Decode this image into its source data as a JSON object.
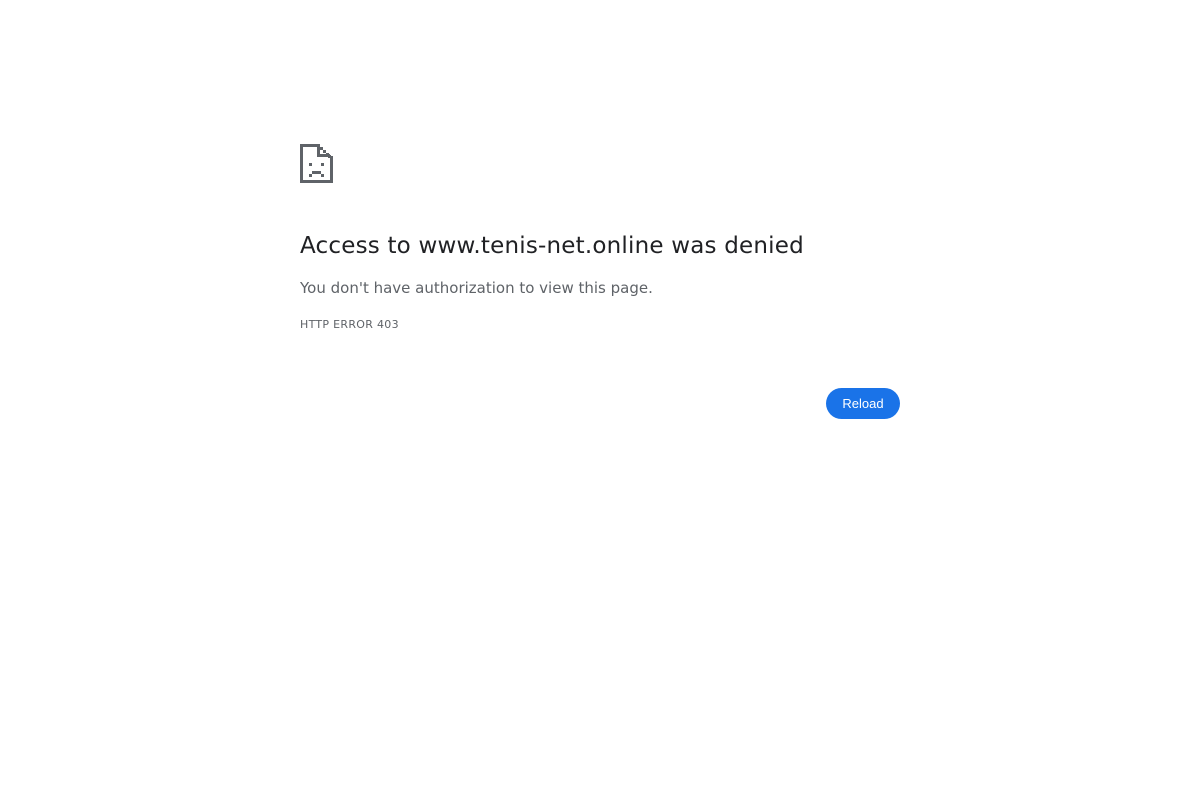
{
  "error_page": {
    "icon": "sad-document-icon",
    "heading_prefix": "Access to ",
    "host": "www.tenis-net.online",
    "heading_suffix": " was denied",
    "message": "You don't have authorization to view this page.",
    "error_code": "HTTP ERROR 403",
    "reload_label": "Reload"
  },
  "colors": {
    "heading": "#202124",
    "secondary_text": "#5f6368",
    "button_bg": "#1a73e8",
    "button_text": "#ffffff",
    "icon": "#5f6368"
  }
}
